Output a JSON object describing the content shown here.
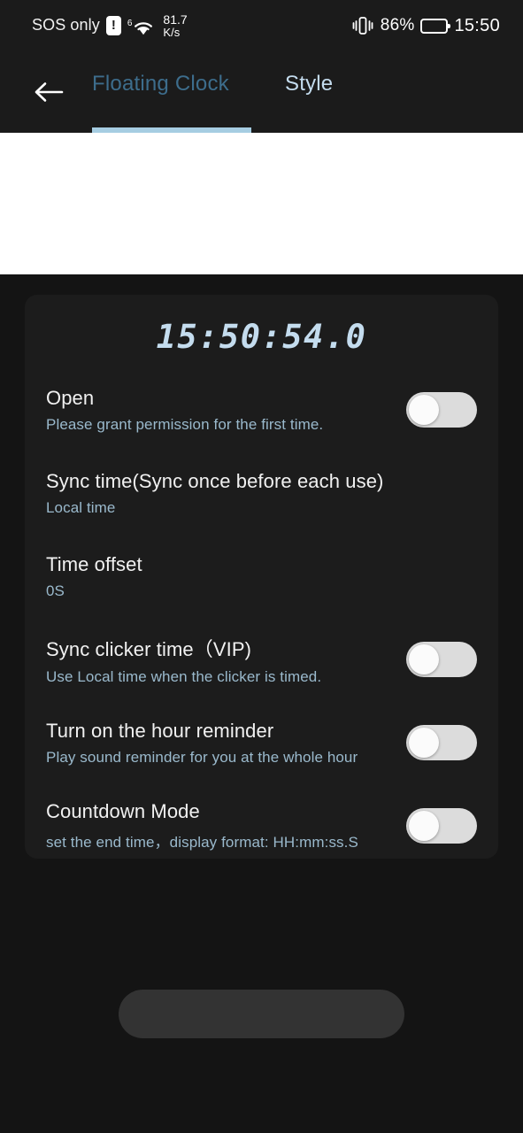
{
  "status_bar": {
    "carrier": "SOS only",
    "warning_badge": "!",
    "wifi_generation": "6",
    "network_speed_value": "81.7",
    "network_speed_unit": "K/s",
    "battery_percent": "86%",
    "clock": "15:50"
  },
  "tab_bar": {
    "back_label": "←",
    "tabs": [
      {
        "label": "Floating Clock",
        "selected": true
      },
      {
        "label": "Style",
        "selected": false
      }
    ]
  },
  "clock": {
    "value": "15:50:54.0"
  },
  "settings": {
    "rows": [
      {
        "title": "Open",
        "subtitle": "Please grant permission for the first time.",
        "toggle": "off"
      },
      {
        "title": "Sync time(Sync once before each use)",
        "subtitle": "Local time",
        "toggle": "none"
      },
      {
        "title": "Time offset",
        "subtitle": "0S",
        "toggle": "none"
      },
      {
        "title": "Sync clicker time（VIP)",
        "subtitle": "Use Local time when the clicker is timed.",
        "toggle": "off"
      },
      {
        "title": "Turn on the hour reminder",
        "subtitle": "Play sound reminder for you at the whole hour",
        "toggle": "off"
      },
      {
        "title": "Countdown Mode",
        "subtitle": "set the end time，display format: HH:mm:ss.S",
        "toggle": "off"
      }
    ]
  },
  "colors": {
    "accent": "#a6cde2",
    "clock_text": "#c4dcee",
    "subtitle": "#9ab9cc",
    "card_bg": "#1c1c1c",
    "page_bg": "#141414",
    "bar_bg": "#1b1b1b"
  }
}
